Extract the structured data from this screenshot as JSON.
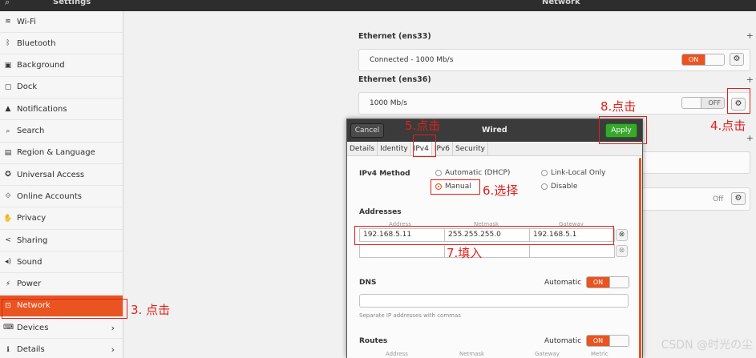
{
  "header": {
    "search_icon": "search-icon",
    "settings_title": "Settings",
    "panel_title": "Network"
  },
  "sidebar": {
    "items": [
      {
        "label": "Wi-Fi",
        "icon": "wifi-icon",
        "glyph": "≋"
      },
      {
        "label": "Bluetooth",
        "icon": "bluetooth-icon",
        "glyph": "ᛒ"
      },
      {
        "label": "Background",
        "icon": "background-icon",
        "glyph": "▣"
      },
      {
        "label": "Dock",
        "icon": "dock-icon",
        "glyph": "▢"
      },
      {
        "label": "Notifications",
        "icon": "bell-icon",
        "glyph": "▲"
      },
      {
        "label": "Search",
        "icon": "search-icon",
        "glyph": "⌕"
      },
      {
        "label": "Region & Language",
        "icon": "region-icon",
        "glyph": "▤"
      },
      {
        "label": "Universal Access",
        "icon": "accessibility-icon",
        "glyph": "✪"
      },
      {
        "label": "Online Accounts",
        "icon": "online-accounts-icon",
        "glyph": "⟐"
      },
      {
        "label": "Privacy",
        "icon": "privacy-hand-icon",
        "glyph": "✋"
      },
      {
        "label": "Sharing",
        "icon": "share-icon",
        "glyph": "<"
      },
      {
        "label": "Sound",
        "icon": "speaker-icon",
        "glyph": "◂)"
      },
      {
        "label": "Power",
        "icon": "power-icon",
        "glyph": "⚡"
      },
      {
        "label": "Network",
        "icon": "network-icon",
        "glyph": "⊡"
      },
      {
        "label": "Devices",
        "icon": "devices-icon",
        "glyph": "⌨"
      },
      {
        "label": "Details",
        "icon": "details-icon",
        "glyph": "ℹ"
      }
    ],
    "active_index": 13,
    "chevron": "›"
  },
  "network": {
    "ethernet1": {
      "title": "Ethernet (ens33)",
      "status": "Connected - 1000 Mb/s",
      "toggle": "ON"
    },
    "ethernet2": {
      "title": "Ethernet (ens36)",
      "status": "1000 Mb/s",
      "toggle": "OFF"
    },
    "plus": "+",
    "proxy_toggle": "Off",
    "gear": "⚙"
  },
  "dialog": {
    "cancel": "Cancel",
    "title": "Wired",
    "apply": "Apply",
    "tabs": [
      "Details",
      "Identity",
      "IPv4",
      "IPv6",
      "Security"
    ],
    "active_tab": "IPv4",
    "ipv4_method_label": "IPv4 Method",
    "methods": {
      "auto": "Automatic (DHCP)",
      "link_local": "Link-Local Only",
      "manual": "Manual",
      "disable": "Disable"
    },
    "selected_method": "Manual",
    "addresses_label": "Addresses",
    "col_address": "Address",
    "col_netmask": "Netmask",
    "col_gateway": "Gateway",
    "address": "192.168.5.11",
    "netmask": "255.255.255.0",
    "gateway": "192.168.5.1",
    "dns_label": "DNS",
    "automatic": "Automatic",
    "on": "ON",
    "dns_hint": "Separate IP addresses with commas",
    "routes_label": "Routes",
    "col_metric": "Metric",
    "clear_icon": "⊗"
  },
  "annotations": {
    "step3": "3. 点击",
    "step4": "4.点击",
    "step5": "5.点击",
    "step6": "6.选择",
    "step7": "7.填入",
    "step8": "8.点击"
  },
  "watermark": "CSDN @时光の尘",
  "colors": {
    "accent": "#e95420",
    "apply_green": "#37a82c",
    "annotation_red": "#e0201a",
    "header_dark": "#2d2d2d"
  }
}
